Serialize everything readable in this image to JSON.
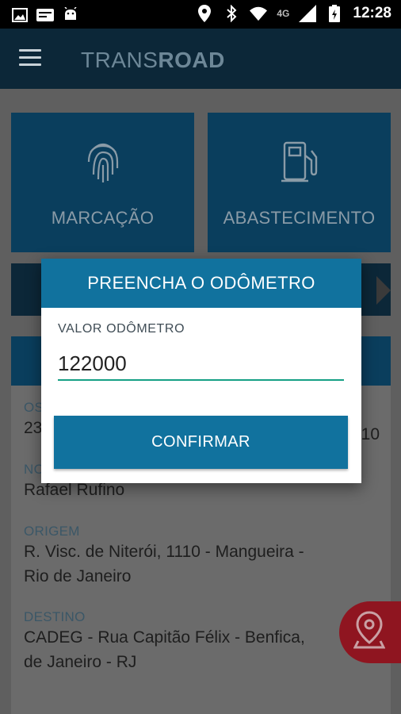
{
  "status_bar": {
    "time": "12:28",
    "network": "4G",
    "left_icons": [
      "image-icon",
      "transroad-app-icon",
      "android-icon"
    ],
    "right_icons": [
      "location-icon",
      "bluetooth-icon",
      "wifi-icon",
      "signal-icon",
      "battery-icon"
    ]
  },
  "app_bar": {
    "logo_part1": "TRANS",
    "logo_part2": "ROAD"
  },
  "tiles": [
    {
      "label": "MARCAÇÃO",
      "icon": "fingerprint-icon"
    },
    {
      "label": "ABASTECIMENTO",
      "icon": "fuel-pump-icon"
    }
  ],
  "details": {
    "os_label": "OS",
    "os_value_left": "23",
    "os_value_right": "10",
    "name_label": "NO",
    "name_value": "Rafael Rufino",
    "origin_label": "ORIGEM",
    "origin_value_line1": "R. Visc. de Niterói, 1110 - Mangueira -",
    "origin_value_line2": "Rio de Janeiro",
    "destination_label": "DESTINO",
    "destination_value_line1": "CADEG - Rua Capitão Félix - Benfica,",
    "destination_value_line2": "de Janeiro - RJ"
  },
  "dialog": {
    "title": "PREENCHA O ODÔMETRO",
    "field_label": "VALOR ODÔMETRO",
    "field_value": "122000",
    "confirm_label": "CONFIRMAR"
  },
  "colors": {
    "primary": "#11729e",
    "appbar": "#0c2738",
    "input_underline": "#16a085",
    "fab": "#8f1520"
  }
}
